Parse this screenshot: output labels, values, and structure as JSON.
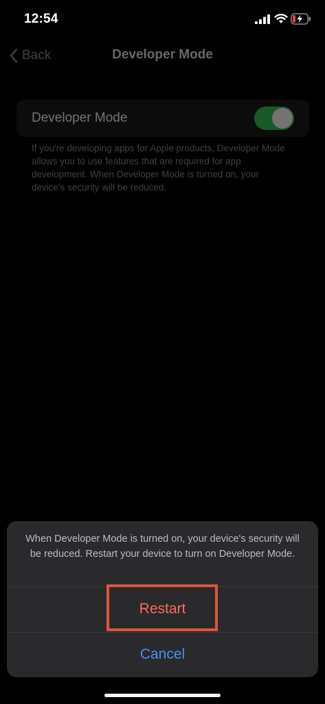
{
  "status_bar": {
    "time": "12:54",
    "icons": [
      "signal-icon",
      "wifi-icon",
      "battery-charging-icon"
    ],
    "battery_color": "#e5483d"
  },
  "nav": {
    "back_label": "Back",
    "title": "Developer Mode"
  },
  "settings": {
    "row_label": "Developer Mode",
    "toggle_on": true,
    "toggle_color": "#34c759",
    "footer_note": "If you're developing apps for Apple products, Developer Mode allows you to use features that are required for app development. When Developer Mode is turned on, your device's security will be reduced."
  },
  "action_sheet": {
    "message": "When Developer Mode is turned on, your device's security will be reduced. Restart your device to turn on Developer Mode.",
    "restart_label": "Restart",
    "cancel_label": "Cancel",
    "highlight_color": "#e1543a"
  }
}
